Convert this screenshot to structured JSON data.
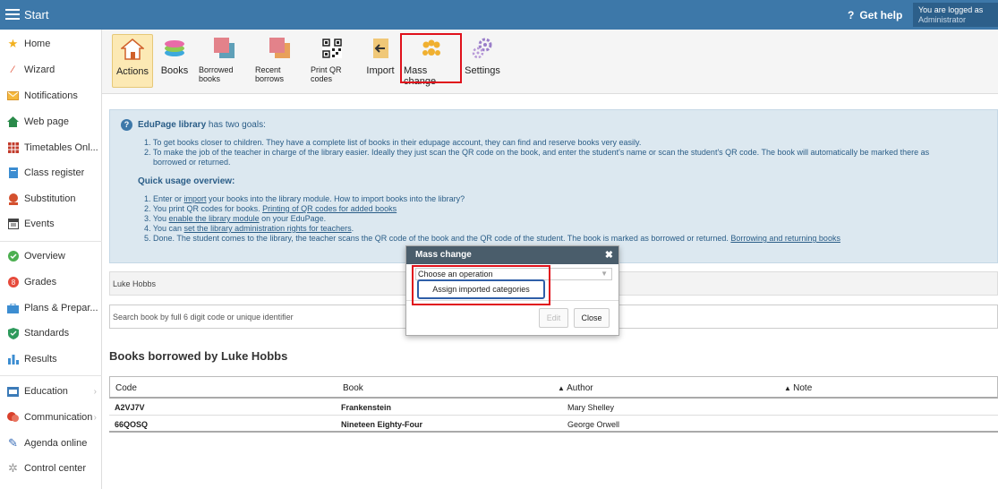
{
  "topbar": {
    "start_label": "Start",
    "help_label": "Get help",
    "login_line1": "You are logged as",
    "login_line2": "Administrator"
  },
  "sidebar": {
    "items": [
      {
        "label": "Home",
        "icon": "star-icon"
      },
      {
        "label": "Wizard",
        "icon": "wand-icon"
      },
      {
        "label": "Notifications",
        "icon": "envelope-icon"
      },
      {
        "label": "Web page",
        "icon": "house-icon"
      },
      {
        "label": "Timetables Onl...",
        "icon": "grid-icon"
      },
      {
        "label": "Class register",
        "icon": "book-icon"
      },
      {
        "label": "Substitution",
        "icon": "person-icon"
      },
      {
        "label": "Events",
        "icon": "calendar-icon"
      },
      {
        "label": "Overview",
        "icon": "check-circle-icon"
      },
      {
        "label": "Grades",
        "icon": "grades-icon"
      },
      {
        "label": "Plans & Prepar...",
        "icon": "briefcase-icon"
      },
      {
        "label": "Standards",
        "icon": "shield-icon"
      },
      {
        "label": "Results",
        "icon": "bars-icon"
      },
      {
        "label": "Education",
        "icon": "education-icon"
      },
      {
        "label": "Communication",
        "icon": "chat-icon"
      },
      {
        "label": "Agenda online",
        "icon": "pen-icon"
      },
      {
        "label": "Control center",
        "icon": "cog-icon"
      }
    ]
  },
  "toolbar": {
    "actions": "Actions",
    "books": "Books",
    "borrowed_books": "Borrowed books",
    "recent_borrows": "Recent borrows",
    "print_qr": "Print QR codes",
    "import": "Import",
    "mass_change": "Mass change",
    "settings": "Settings"
  },
  "info": {
    "intro_bold": "EduPage library",
    "intro_rest": " has two goals:",
    "goal1": "1. To get books closer to children. They have a complete list of books in their edupage account, they can find and reserve books very easily.",
    "goal2a": "2. To make the job of the teacher in charge of the library easier. Ideally they just scan the QR code on the book, and enter the student's name or scan the student's QR code. The book will automatically be marked there as",
    "goal2b": "borrowed or returned.",
    "quick_title": "Quick usage overview:",
    "q1a": "1. Enter or ",
    "q1link": "import",
    "q1b": " your books into the library module. How to import books into the library?",
    "q2a": "2. You print QR codes for books. ",
    "q2link": "Printing of QR codes for added books",
    "q3a": "3. You ",
    "q3link": "enable the library module",
    "q3b": " on your EduPage.",
    "q4a": "4. You can ",
    "q4link": "set the library administration rights for teachers",
    "q4b": ".",
    "q5a": "5. Done. The student comes to the library, the teacher scans the QR code of the book and the QR code of the student. The book is marked as borrowed or returned. ",
    "q5link": "Borrowing and returning books"
  },
  "student_field": "Luke Hobbs",
  "search_placeholder": "Search book by full 6 digit code or unique identifier",
  "books_title": "Books borrowed by Luke Hobbs",
  "table": {
    "headers": [
      "Code",
      "Book",
      "Author",
      "Note"
    ],
    "rows": [
      {
        "code": "A2VJ7V",
        "book": "Frankenstein",
        "author": "Mary Shelley",
        "note": ""
      },
      {
        "code": "66QOSQ",
        "book": "Nineteen Eighty-Four",
        "author": "George Orwell",
        "note": ""
      }
    ]
  },
  "modal": {
    "title": "Mass change",
    "select_value": "Choose an operation",
    "option_highlighted": "Assign imported categories",
    "edit_label": "Edit",
    "close_label": "Close"
  },
  "colors": {
    "topbar": "#3d78a9",
    "highlight_red": "#e0111b",
    "info_bg": "#dce8f0",
    "modal_header": "#4a5d6b"
  }
}
